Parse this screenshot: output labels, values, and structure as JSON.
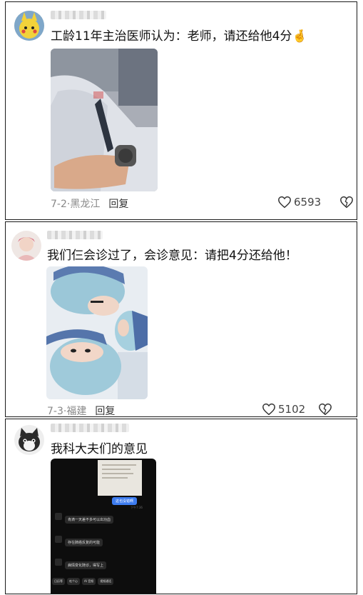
{
  "comments": [
    {
      "username": "",
      "text": "工龄11年主治医师认为：老师，请还给他4分🤞",
      "date": "7-2",
      "location": "黑龙江",
      "reply_label": "回复",
      "likes": "6593",
      "avatar_icon": "yellow-cartoon-avatar-icon",
      "image_description": "doctor-white-coat-photo"
    },
    {
      "username": "",
      "text": "我们仨会诊过了，会诊意见：请把4分还给他！",
      "date": "7-3",
      "location": "福建",
      "reply_label": "回复",
      "likes": "5102",
      "avatar_icon": "person-avatar-icon",
      "image_description": "three-nurses-masks-selfie"
    },
    {
      "username": "",
      "text": "我科大夫们的意见",
      "avatar_icon": "black-white-cat-avatar-icon",
      "image_description": "chat-screenshot",
      "chat": {
        "blue_bubble": "这也没错啊",
        "timestamp": "下午7:36",
        "bubbles": [
          "肯滴一天差不多可以出功血",
          "存在肺癌反复的可能",
          "病情变化随诊，得写上"
        ],
        "bottom_tabs": [
          "日历等",
          "吃个心",
          "AI 音频",
          "视频通话"
        ]
      }
    }
  ]
}
